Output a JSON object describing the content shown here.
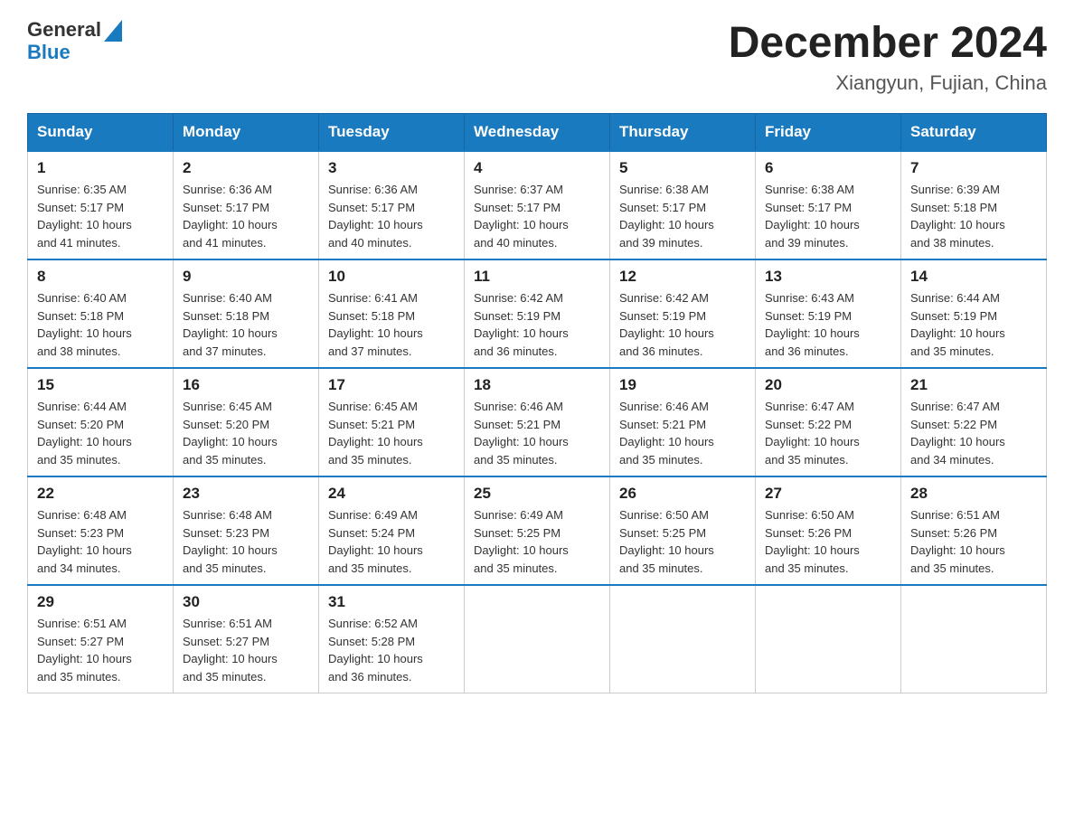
{
  "header": {
    "logo_text1": "General",
    "logo_text2": "Blue",
    "title": "December 2024",
    "subtitle": "Xiangyun, Fujian, China"
  },
  "days_of_week": [
    "Sunday",
    "Monday",
    "Tuesday",
    "Wednesday",
    "Thursday",
    "Friday",
    "Saturday"
  ],
  "weeks": [
    [
      {
        "day": "1",
        "sunrise": "6:35 AM",
        "sunset": "5:17 PM",
        "daylight": "10 hours and 41 minutes."
      },
      {
        "day": "2",
        "sunrise": "6:36 AM",
        "sunset": "5:17 PM",
        "daylight": "10 hours and 41 minutes."
      },
      {
        "day": "3",
        "sunrise": "6:36 AM",
        "sunset": "5:17 PM",
        "daylight": "10 hours and 40 minutes."
      },
      {
        "day": "4",
        "sunrise": "6:37 AM",
        "sunset": "5:17 PM",
        "daylight": "10 hours and 40 minutes."
      },
      {
        "day": "5",
        "sunrise": "6:38 AM",
        "sunset": "5:17 PM",
        "daylight": "10 hours and 39 minutes."
      },
      {
        "day": "6",
        "sunrise": "6:38 AM",
        "sunset": "5:17 PM",
        "daylight": "10 hours and 39 minutes."
      },
      {
        "day": "7",
        "sunrise": "6:39 AM",
        "sunset": "5:18 PM",
        "daylight": "10 hours and 38 minutes."
      }
    ],
    [
      {
        "day": "8",
        "sunrise": "6:40 AM",
        "sunset": "5:18 PM",
        "daylight": "10 hours and 38 minutes."
      },
      {
        "day": "9",
        "sunrise": "6:40 AM",
        "sunset": "5:18 PM",
        "daylight": "10 hours and 37 minutes."
      },
      {
        "day": "10",
        "sunrise": "6:41 AM",
        "sunset": "5:18 PM",
        "daylight": "10 hours and 37 minutes."
      },
      {
        "day": "11",
        "sunrise": "6:42 AM",
        "sunset": "5:19 PM",
        "daylight": "10 hours and 36 minutes."
      },
      {
        "day": "12",
        "sunrise": "6:42 AM",
        "sunset": "5:19 PM",
        "daylight": "10 hours and 36 minutes."
      },
      {
        "day": "13",
        "sunrise": "6:43 AM",
        "sunset": "5:19 PM",
        "daylight": "10 hours and 36 minutes."
      },
      {
        "day": "14",
        "sunrise": "6:44 AM",
        "sunset": "5:19 PM",
        "daylight": "10 hours and 35 minutes."
      }
    ],
    [
      {
        "day": "15",
        "sunrise": "6:44 AM",
        "sunset": "5:20 PM",
        "daylight": "10 hours and 35 minutes."
      },
      {
        "day": "16",
        "sunrise": "6:45 AM",
        "sunset": "5:20 PM",
        "daylight": "10 hours and 35 minutes."
      },
      {
        "day": "17",
        "sunrise": "6:45 AM",
        "sunset": "5:21 PM",
        "daylight": "10 hours and 35 minutes."
      },
      {
        "day": "18",
        "sunrise": "6:46 AM",
        "sunset": "5:21 PM",
        "daylight": "10 hours and 35 minutes."
      },
      {
        "day": "19",
        "sunrise": "6:46 AM",
        "sunset": "5:21 PM",
        "daylight": "10 hours and 35 minutes."
      },
      {
        "day": "20",
        "sunrise": "6:47 AM",
        "sunset": "5:22 PM",
        "daylight": "10 hours and 35 minutes."
      },
      {
        "day": "21",
        "sunrise": "6:47 AM",
        "sunset": "5:22 PM",
        "daylight": "10 hours and 34 minutes."
      }
    ],
    [
      {
        "day": "22",
        "sunrise": "6:48 AM",
        "sunset": "5:23 PM",
        "daylight": "10 hours and 34 minutes."
      },
      {
        "day": "23",
        "sunrise": "6:48 AM",
        "sunset": "5:23 PM",
        "daylight": "10 hours and 35 minutes."
      },
      {
        "day": "24",
        "sunrise": "6:49 AM",
        "sunset": "5:24 PM",
        "daylight": "10 hours and 35 minutes."
      },
      {
        "day": "25",
        "sunrise": "6:49 AM",
        "sunset": "5:25 PM",
        "daylight": "10 hours and 35 minutes."
      },
      {
        "day": "26",
        "sunrise": "6:50 AM",
        "sunset": "5:25 PM",
        "daylight": "10 hours and 35 minutes."
      },
      {
        "day": "27",
        "sunrise": "6:50 AM",
        "sunset": "5:26 PM",
        "daylight": "10 hours and 35 minutes."
      },
      {
        "day": "28",
        "sunrise": "6:51 AM",
        "sunset": "5:26 PM",
        "daylight": "10 hours and 35 minutes."
      }
    ],
    [
      {
        "day": "29",
        "sunrise": "6:51 AM",
        "sunset": "5:27 PM",
        "daylight": "10 hours and 35 minutes."
      },
      {
        "day": "30",
        "sunrise": "6:51 AM",
        "sunset": "5:27 PM",
        "daylight": "10 hours and 35 minutes."
      },
      {
        "day": "31",
        "sunrise": "6:52 AM",
        "sunset": "5:28 PM",
        "daylight": "10 hours and 36 minutes."
      },
      null,
      null,
      null,
      null
    ]
  ],
  "labels": {
    "sunrise": "Sunrise:",
    "sunset": "Sunset:",
    "daylight": "Daylight:"
  }
}
